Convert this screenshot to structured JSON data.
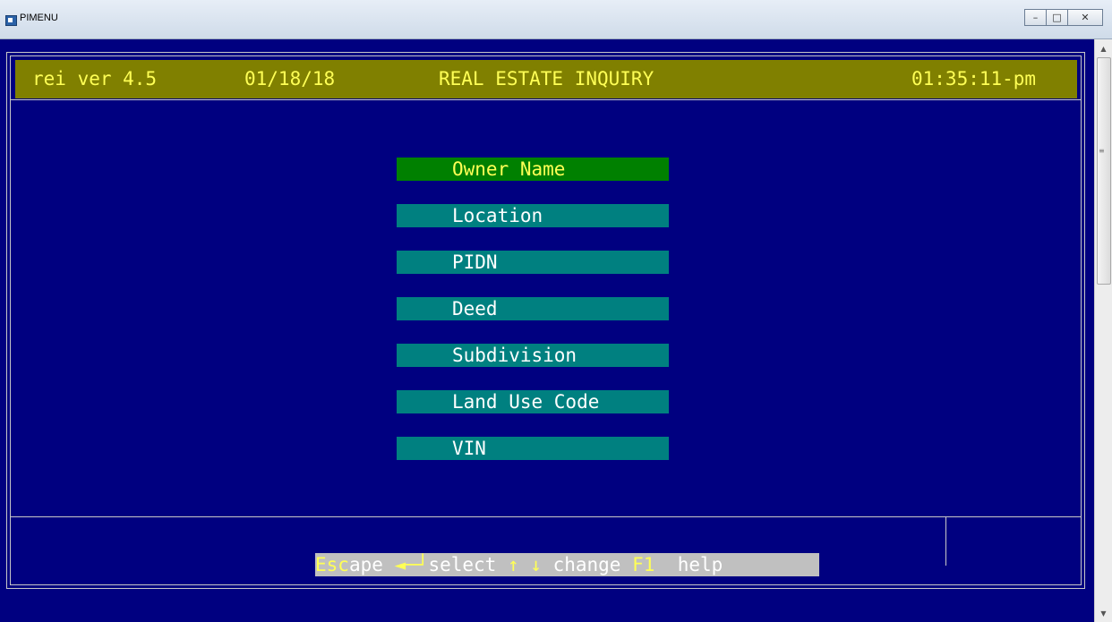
{
  "window": {
    "title": "PIMENU",
    "buttons": {
      "minimize": "–",
      "maximize": "□",
      "close": "✕"
    }
  },
  "header": {
    "program": "rei ver 4.5",
    "date": "01/18/18",
    "title": "REAL ESTATE INQUIRY",
    "time": "01:35:11-pm"
  },
  "menu": {
    "selected_index": 0,
    "items": [
      {
        "label": "Owner Name"
      },
      {
        "label": "Location"
      },
      {
        "label": "PIDN"
      },
      {
        "label": "Deed"
      },
      {
        "label": "Subdivision"
      },
      {
        "label": "Land Use Code"
      },
      {
        "label": "VIN"
      }
    ]
  },
  "status": {
    "esc_key": "Esc",
    "esc_rest": "ape",
    "enter_key": "◄─┘",
    "enter_text": "select",
    "arrows_key": "↑ ↓",
    "arrows_text": "change",
    "f1_key": "F1",
    "f1_text": "help"
  },
  "colors": {
    "background": "#000080",
    "header_bar": "#808000",
    "menu_item": "#008080",
    "menu_selected": "#008000",
    "highlight_text": "#ffff55",
    "status_bar": "#c0c0c0"
  },
  "icons": {
    "app": "window-app-icon",
    "scroll_up": "chevron-up-icon",
    "scroll_down": "chevron-down-icon"
  }
}
